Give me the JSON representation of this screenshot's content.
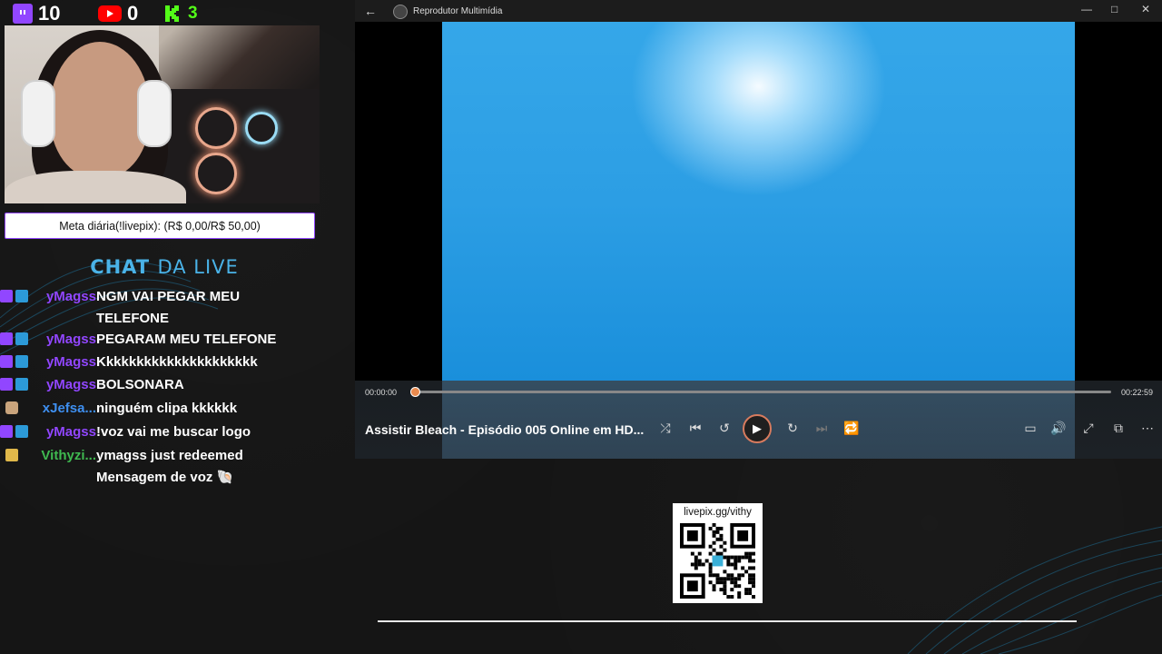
{
  "stats": {
    "twitch_count": "10",
    "youtube_count": "0",
    "kick_count": "3"
  },
  "goal": {
    "text": "Meta diária(!livepix): (R$ 0,00/R$ 50,00)"
  },
  "chat_title": {
    "part1": "CHAT",
    "part2": "DA LIVE"
  },
  "chat": [
    {
      "user": "yMagss",
      "user_color": "#9146ff",
      "text": "NGM VAI PEGAR MEU TELEFONE",
      "badges": [
        "twitch",
        "prime"
      ]
    },
    {
      "user": "yMagss",
      "user_color": "#9146ff",
      "text": "PEGARAM MEU TELEFONE",
      "badges": [
        "twitch",
        "prime"
      ]
    },
    {
      "user": "yMagss",
      "user_color": "#9146ff",
      "text": "Kkkkkkkkkkkkkkkkkkkkk",
      "badges": [
        "twitch",
        "prime"
      ]
    },
    {
      "user": "yMagss",
      "user_color": "#9146ff",
      "text": "BOLSONARA",
      "badges": [
        "twitch",
        "prime"
      ]
    },
    {
      "user": "xJefsa...",
      "user_color": "#3e8ff0",
      "text": "ninguém clipa kkkkkk",
      "badges": [
        "bear"
      ]
    },
    {
      "user": "yMagss",
      "user_color": "#9146ff",
      "text": "!voz vai me buscar logo",
      "badges": [
        "twitch",
        "prime"
      ]
    },
    {
      "user": "Vithyzi...",
      "user_color": "#3fb950",
      "text": "ymagss just redeemed Mensagem de voz 🐚",
      "badges": [
        "crown"
      ]
    }
  ],
  "player": {
    "app_title": "Reprodutor Multimídia",
    "current_time": "00:00:00",
    "total_time": "00:22:59",
    "progress": 0.0,
    "media_title": "Assistir Bleach - Episódio 005 Online em HD...",
    "controls": [
      "shuffle-icon",
      "previous-icon",
      "rewind-10-icon",
      "play-icon",
      "forward-30-icon",
      "next-icon",
      "repeat-icon",
      "miniplayer-icon",
      "volume-icon",
      "fullscreen-icon",
      "cast-icon",
      "more-icon"
    ],
    "window_controls": [
      "minimize",
      "maximize",
      "close"
    ]
  },
  "qr": {
    "label": "livepix.gg/vithy"
  },
  "colors": {
    "accent": "#9146ff",
    "title_blue": "#4ab3e8",
    "kick_green": "#53fc18",
    "seek_knob": "#e98a4e"
  }
}
